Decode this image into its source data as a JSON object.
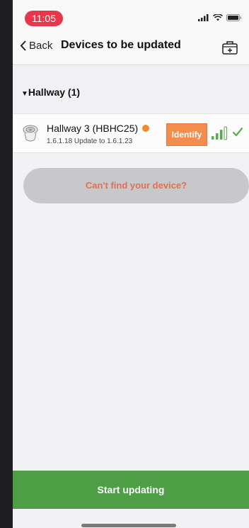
{
  "status_bar": {
    "time": "11:05",
    "icons": [
      "signal-icon",
      "wifi-icon",
      "battery-icon"
    ]
  },
  "nav": {
    "back_label": "Back",
    "title": "Devices to be updated",
    "action_icon": "add-device-icon"
  },
  "group": {
    "label": "Hallway (1)"
  },
  "device": {
    "name": "Hallway 3 (HBHC25)",
    "status_color": "#f08a2c",
    "update_text": "1.6.1.18 Update to 1.6.1.23",
    "identify_label": "Identify",
    "signal_icon": "signal-strength-icon",
    "status_icon": "check-icon"
  },
  "cant_find_label": "Can't find your device?",
  "start_label": "Start updating",
  "colors": {
    "accent_green": "#4d9e45",
    "accent_orange": "#f28d4d",
    "time_pill": "#e8364d"
  }
}
